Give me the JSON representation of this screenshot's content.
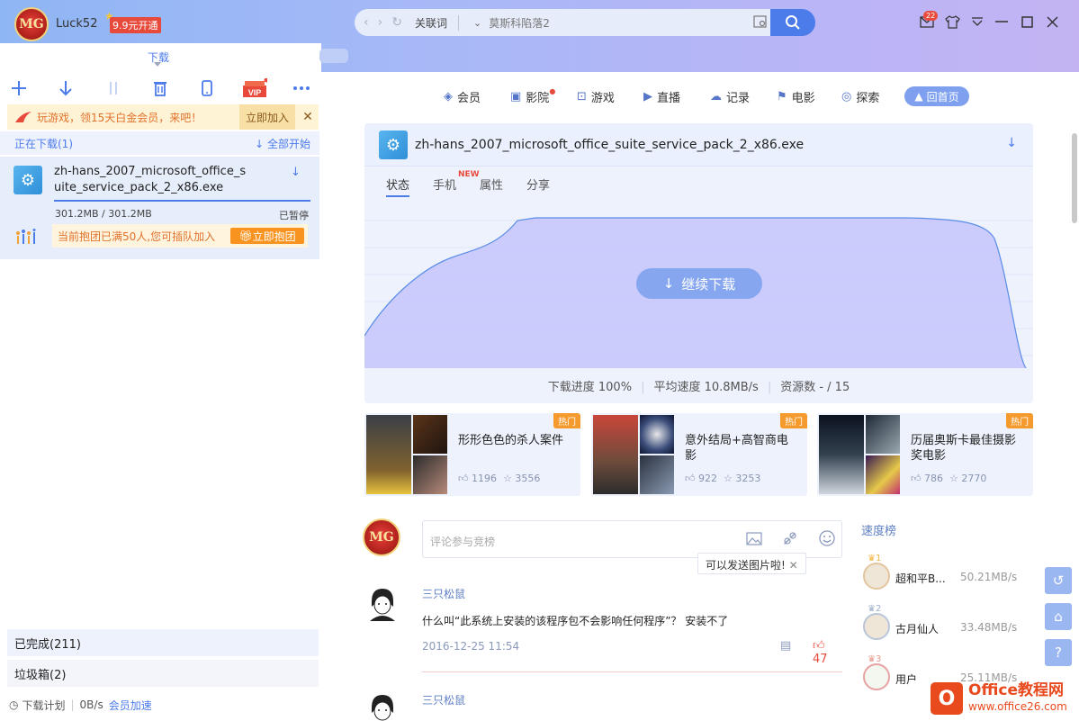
{
  "user": {
    "name": "Luck52",
    "avatar_text": "MG",
    "vip_label": "9.9元开通",
    "mail_count": "22"
  },
  "addressbar": {
    "keyword_label": "关联词",
    "value": "莫斯科陷落2"
  },
  "left": {
    "tab_label": "下载",
    "promo": {
      "text": "玩游戏，领15天白金会员，来吧！",
      "join": "立即加入",
      "close": "✕"
    },
    "downloading_title": "正在下载(1)",
    "start_all": "全部开始",
    "item": {
      "name": "zh-hans_2007_microsoft_office_suite_service_pack_2_x86.exe",
      "size": "301.2MB / 301.2MB",
      "status": "已暂停",
      "progress": 1.0
    },
    "group": {
      "text": "当前抱团已满50人,您可插队加入",
      "button": "立即抱团"
    },
    "completed": "已完成(211)",
    "trash": "垃圾箱(2)",
    "footer": {
      "plan": "下载计划",
      "speed": "0B/s",
      "accel": "会员加速"
    }
  },
  "nav": {
    "items": [
      "会员",
      "影院",
      "游戏",
      "直播",
      "记录",
      "电影",
      "探索"
    ],
    "home": "回首页"
  },
  "detail": {
    "title": "zh-hans_2007_microsoft_office_suite_service_pack_2_x86.exe",
    "tabs": [
      "状态",
      "手机",
      "属性",
      "分享"
    ],
    "new_tag": "NEW",
    "resume": "继续下载",
    "progress": "下载进度 100%",
    "speed": "平均速度 10.8MB/s",
    "sources": "资源数 - / 15"
  },
  "cards": [
    {
      "title": "形形色色的杀人案件",
      "likes": "1196",
      "favs": "3556",
      "tag": "热门"
    },
    {
      "title": "意外结局+高智商电影",
      "likes": "922",
      "favs": "3253",
      "tag": "热门"
    },
    {
      "title": "历届奥斯卡最佳摄影奖电影",
      "likes": "786",
      "favs": "2770",
      "tag": "热门"
    }
  ],
  "comment": {
    "placeholder": "评论参与竞榜",
    "tooltip": "可以发送图片啦!",
    "tooltip_close": "✕"
  },
  "comments": [
    {
      "user": "三只松鼠",
      "text": "什么叫“此系统上安装的该程序包不会影响任何程序”？  安装不了",
      "date": "2016-12-25 11:54",
      "likes": "47"
    },
    {
      "user": "三只松鼠"
    }
  ],
  "rank": {
    "title": "速度榜",
    "items": [
      {
        "place": "1",
        "name": "超和平B...",
        "speed": "50.21MB/s"
      },
      {
        "place": "2",
        "name": "古月仙人",
        "speed": "33.48MB/s"
      },
      {
        "place": "3",
        "name": "用户",
        "speed": "25.11MB/s"
      }
    ]
  },
  "watermark": {
    "main": "Office教程网",
    "sub": "www.office26.com"
  }
}
